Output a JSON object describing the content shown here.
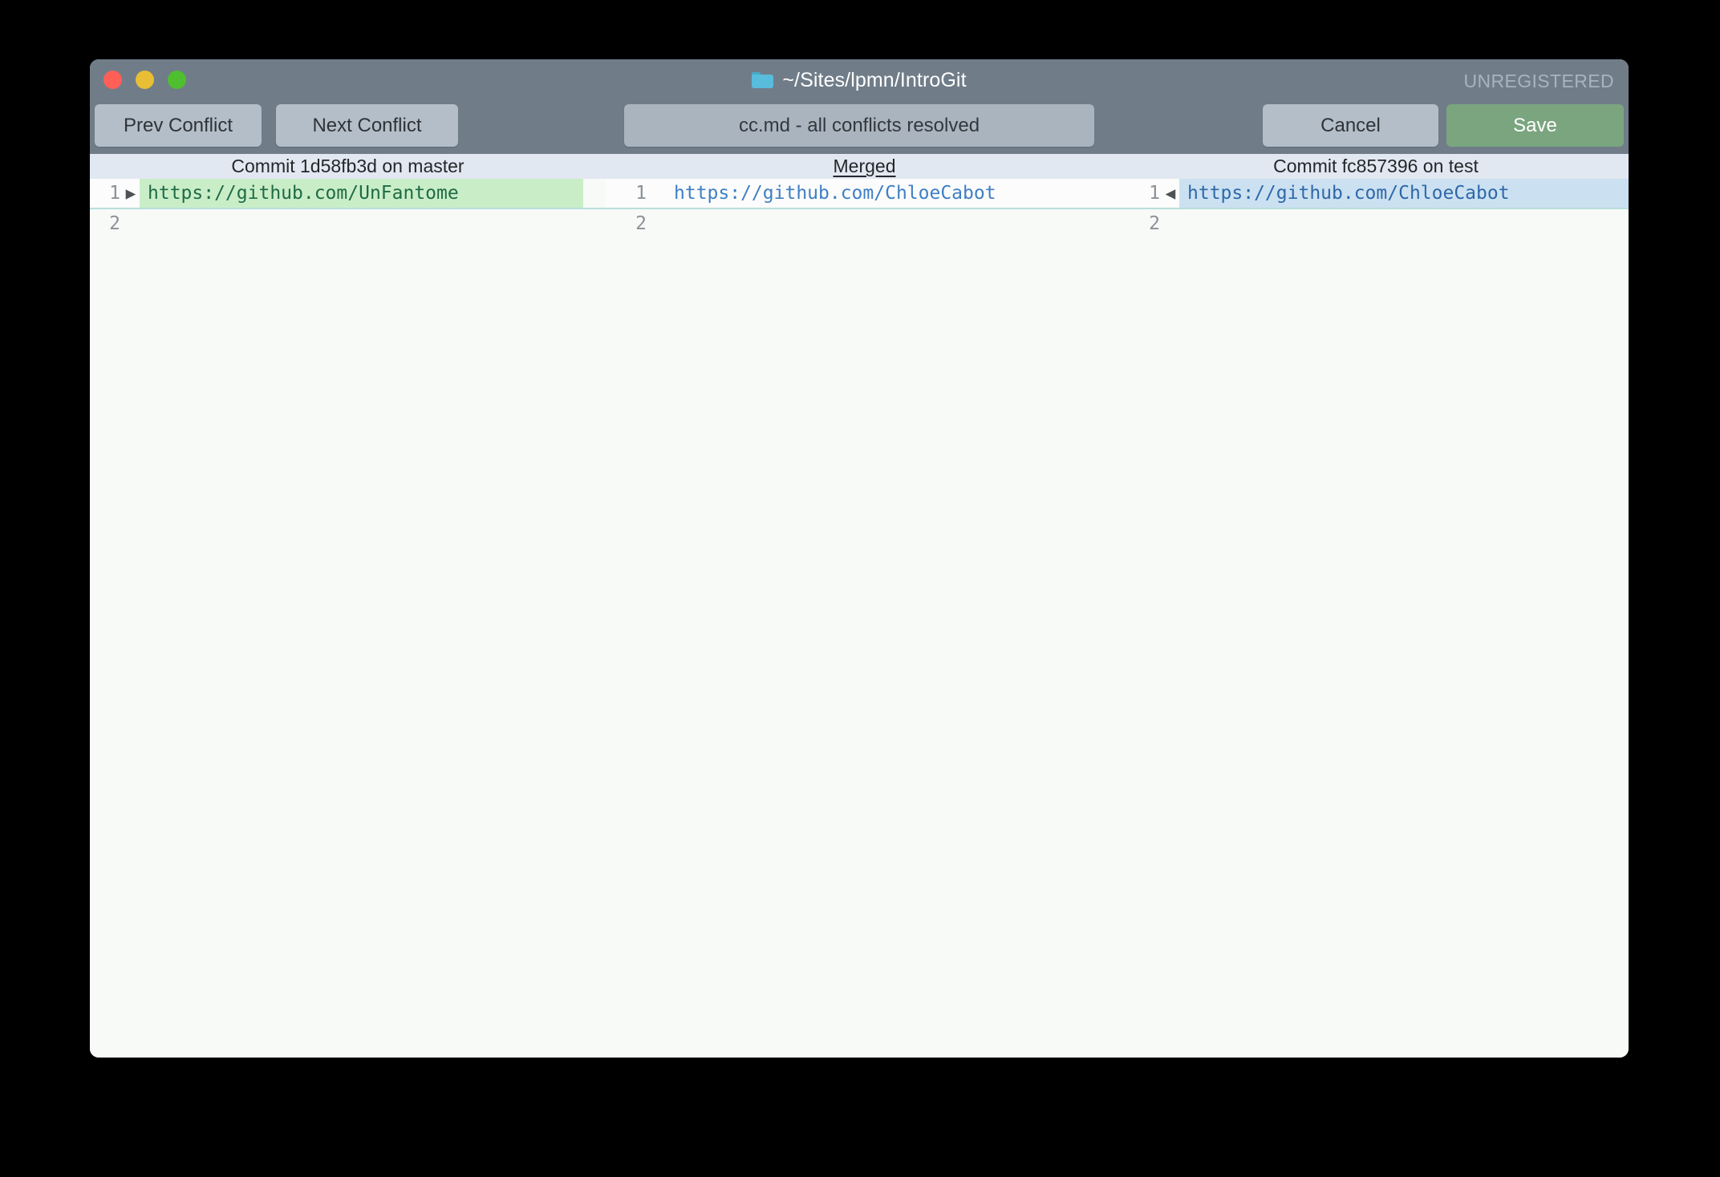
{
  "window": {
    "title": "~/Sites/lpmn/IntroGit",
    "folder_icon": "folder-icon",
    "unregistered_label": "UNREGISTERED",
    "traffic_lights": {
      "close_color": "#ff5f57",
      "minimize_color": "#e8bf34",
      "maximize_color": "#4fbf2f"
    },
    "titlebar_color": "#707d89"
  },
  "toolbar": {
    "prev_conflict_label": "Prev Conflict",
    "next_conflict_label": "Next Conflict",
    "status_text": "cc.md - all conflicts resolved",
    "cancel_label": "Cancel",
    "save_label": "Save",
    "save_color": "#7aa57f",
    "button_color": "#b4bec8"
  },
  "columns": {
    "left_header": "Commit 1d58fb3d on master",
    "center_header": "Merged",
    "right_header": "Commit fc857396 on test",
    "header_background": "#e2e8f1"
  },
  "diff": {
    "left": {
      "lines": [
        {
          "number": "1",
          "marker": "▶",
          "text": "https://github.com/UnFantome",
          "highlight": "green"
        },
        {
          "number": "2",
          "marker": "",
          "text": "",
          "highlight": "none"
        }
      ]
    },
    "center": {
      "lines": [
        {
          "number": "1",
          "marker": "",
          "text": "https://github.com/ChloeCabot",
          "highlight": "none"
        },
        {
          "number": "2",
          "marker": "",
          "text": "",
          "highlight": "none"
        }
      ]
    },
    "right": {
      "lines": [
        {
          "number": "1",
          "marker": "◀",
          "text": "https://github.com/ChloeCabot",
          "highlight": "blue"
        },
        {
          "number": "2",
          "marker": "",
          "text": "",
          "highlight": "none"
        }
      ]
    },
    "colors": {
      "added_highlight": "#c9eec7",
      "theirs_highlight": "#cbe1f1",
      "link_text": "#3f7fc5",
      "row_divider": "#b8dfdc"
    }
  }
}
